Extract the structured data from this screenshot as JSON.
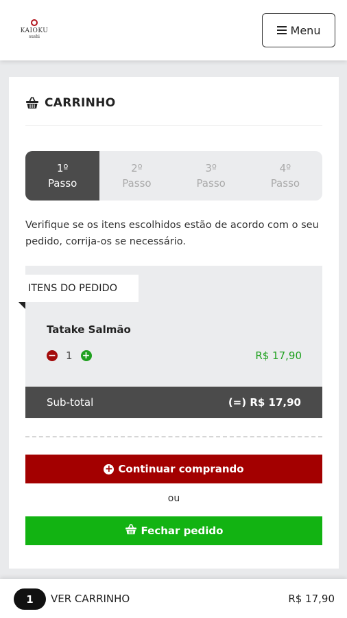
{
  "header": {
    "logo_name": "KAIOKU",
    "logo_sub": "sushi",
    "menu_label": "Menu"
  },
  "cart": {
    "title": "CARRINHO",
    "steps": [
      {
        "number": "1º",
        "label": "Passo",
        "active": true
      },
      {
        "number": "2º",
        "label": "Passo",
        "active": false
      },
      {
        "number": "3º",
        "label": "Passo",
        "active": false
      },
      {
        "number": "4º",
        "label": "Passo",
        "active": false
      }
    ],
    "intro": "Verifique se os itens escolhidos estão de acordo com o seu pedido, corrija-os se necessário.",
    "items_label": "ITENS DO PEDIDO",
    "items": [
      {
        "name": "Tatake Salmão",
        "quantity": "1",
        "price": "R$ 17,90"
      }
    ],
    "subtotal_label": "Sub-total",
    "subtotal_value": "(=) R$ 17,90",
    "continue_label": "Continuar comprando",
    "or_label": "ou",
    "checkout_label": "Fechar pedido"
  },
  "bottom_bar": {
    "count": "1",
    "view_cart_label": "VER CARRINHO",
    "total": "R$ 17,90"
  },
  "colors": {
    "accent_red": "#a30000",
    "accent_green": "#12b312",
    "dark": "#4b4b4b"
  }
}
